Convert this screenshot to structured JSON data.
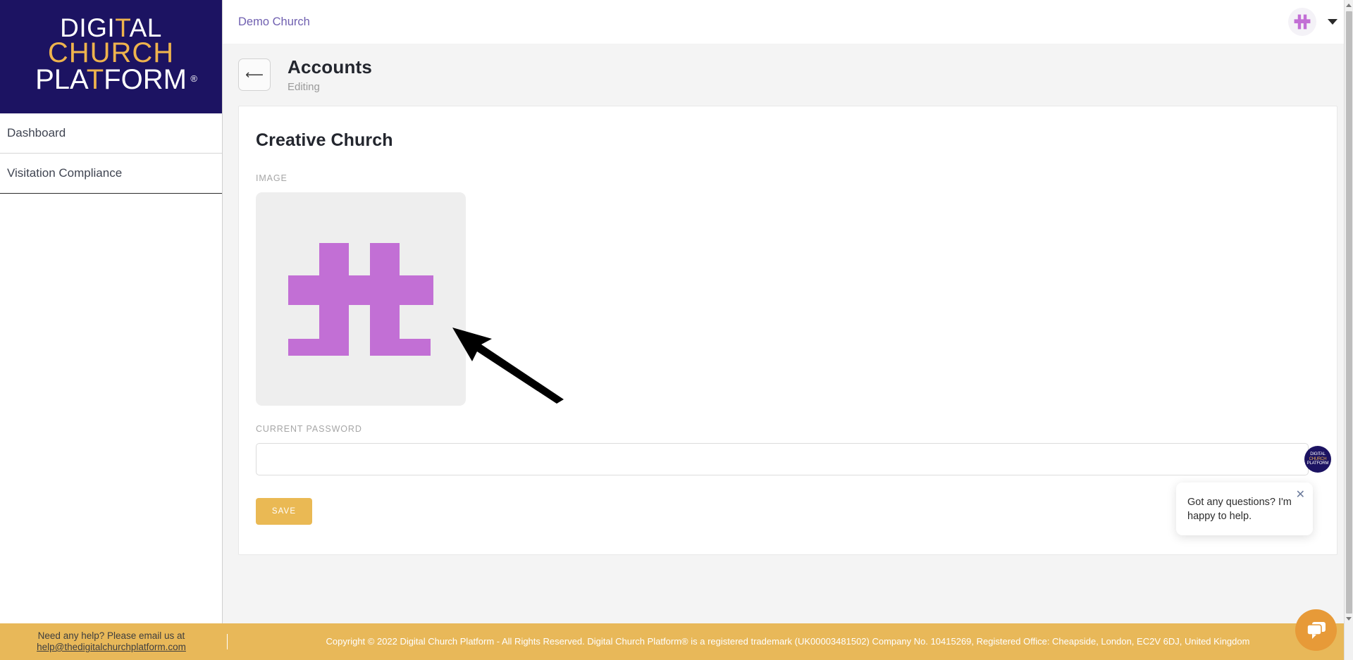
{
  "brand": {
    "logo_line1_a": "DIGI",
    "logo_line1_cross": "T",
    "logo_line1_b": "AL",
    "logo_line2": "CHURCH",
    "logo_line3_a": "PLA",
    "logo_line3_cross": "T",
    "logo_line3_b": "FORM",
    "registered_mark": "®",
    "primary_navy": "#1C1362",
    "accent_gold": "#EEB34D",
    "accent_purple": "#C26FD5",
    "chat_orange": "#E79A38"
  },
  "sidebar": {
    "items": [
      {
        "label": "Dashboard"
      },
      {
        "label": "Visitation Compliance"
      }
    ]
  },
  "topbar": {
    "org_name": "Demo Church",
    "avatar_icon": "double-cross-logo-icon",
    "chevron_icon": "chevron-down-icon"
  },
  "page_header": {
    "back_icon": "arrow-left-icon",
    "title": "Accounts",
    "subtitle": "Editing"
  },
  "card": {
    "title": "Creative Church",
    "image_label": "IMAGE",
    "image_alt": "double-cross-logo-image",
    "password_label": "CURRENT PASSWORD",
    "password_value": "",
    "password_placeholder": "",
    "save_label": "SAVE"
  },
  "annotation": {
    "type": "arrow",
    "description": "black arrow pointing to church image"
  },
  "chat": {
    "avatar_l1": "DIGITAL",
    "avatar_l2": "CHURCH",
    "avatar_l3": "PLATFORM",
    "avatar_reg": "®",
    "message": "Got any questions? I'm happy to help.",
    "close_icon": "close-icon",
    "fab_icon": "chat-bubble-icon"
  },
  "footer": {
    "help_text": "Need any help? Please email us at",
    "help_email": "help@thedigitalchurchplatform.com",
    "copyright": "Copyright © 2022 Digital Church Platform - All Rights Reserved. Digital Church Platform® is a registered trademark (UK00003481502) Company No. 10415269, Registered Office: Cheapside, London, EC2V 6DJ, United Kingdom"
  },
  "scrollbar": {
    "up_icon": "scroll-up-arrow-icon",
    "down_icon": "scroll-down-arrow-icon"
  }
}
